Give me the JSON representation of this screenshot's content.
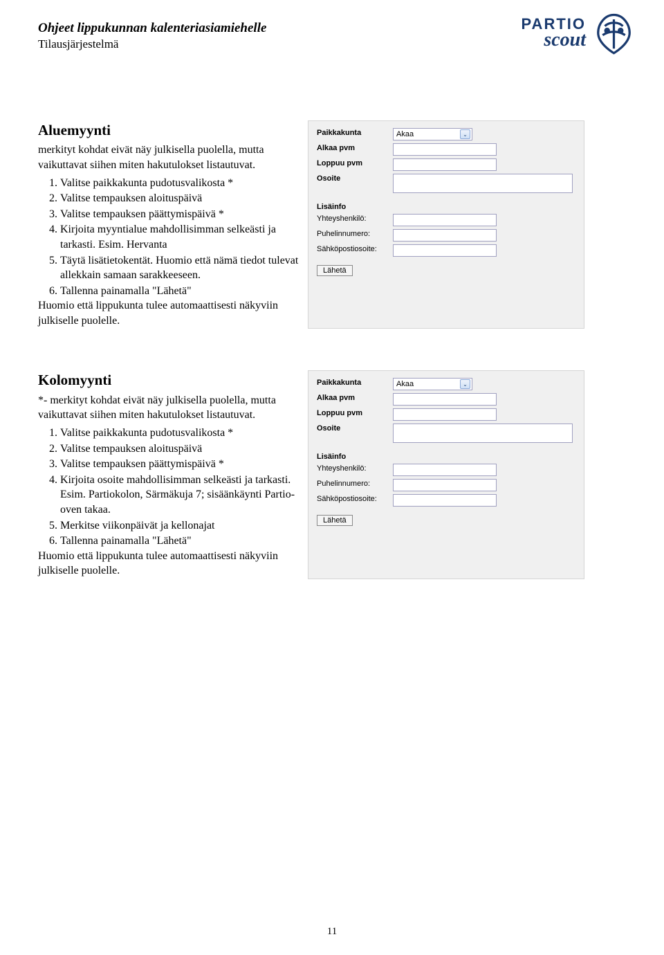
{
  "header": {
    "title": "Ohjeet lippukunnan kalenteriasiamiehelle",
    "subtitle": "Tilausjärjestelmä"
  },
  "logo": {
    "line1": "PARTIO",
    "line2": "scout"
  },
  "sectionA": {
    "title": "Aluemyynti",
    "intro": "merkityt kohdat eivät näy julkisella puolella, mutta vaikuttavat siihen miten hakutulokset listautuvat.",
    "items": {
      "i1": "Valitse paikkakunta pudotusvalikosta *",
      "i2": "Valitse tempauksen aloituspäivä",
      "i3": "Valitse tempauksen päättymispäivä *",
      "i4": "Kirjoita myyntialue mahdollisimman selkeästi ja tarkasti. Esim. Hervanta",
      "i5": "Täytä lisätietokentät. Huomio että nämä tiedot tulevat allekkain samaan sarakkeeseen.",
      "i6": "Tallenna painamalla \"Lähetä\""
    },
    "outro": "Huomio että lippukunta tulee automaattisesti näkyviin julkiselle puolelle."
  },
  "sectionB": {
    "title": "Kolomyynti",
    "intro": "*- merkityt kohdat eivät näy julkisella puolella, mutta vaikuttavat siihen miten hakutulokset listautuvat.",
    "items": {
      "i1": "Valitse paikkakunta pudotusvalikosta *",
      "i2": "Valitse tempauksen aloituspäivä",
      "i3": "Valitse tempauksen päättymispäivä *",
      "i4": "Kirjoita osoite mahdollisimman selkeästi ja tarkasti. Esim. Partiokolon, Särmäkuja 7; sisäänkäynti Partio-oven takaa.",
      "i5": "Merkitse viikonpäivät ja kellonajat",
      "i6": "Tallenna painamalla \"Lähetä\""
    },
    "outro": "Huomio että lippukunta tulee automaattisesti näkyviin julkiselle puolelle."
  },
  "form": {
    "paikkakunta": "Paikkakunta",
    "paikkakunta_value": "Akaa",
    "alkaa": "Alkaa pvm",
    "loppuu": "Loppuu pvm",
    "osoite": "Osoite",
    "lisainfo": "Lisäinfo",
    "yhteys": "Yhteyshenkilö:",
    "puhelin": "Puhelinnumero:",
    "email": "Sähköpostiosoite:",
    "submit": "Lähetä"
  },
  "page": "11"
}
